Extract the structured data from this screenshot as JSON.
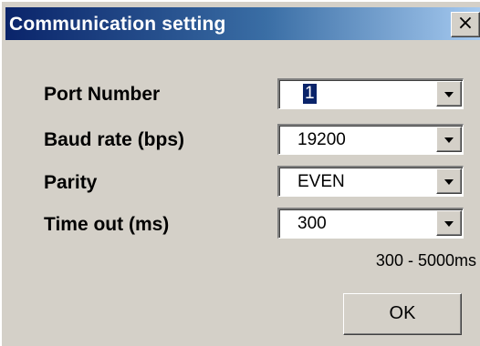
{
  "window": {
    "title": "Communication setting",
    "close_glyph": "×",
    "colors": {
      "title_start": "#0a246a",
      "title_end": "#a6caf0",
      "face": "#d4d0c8"
    }
  },
  "fields": [
    {
      "label": "Port Number",
      "value": "1"
    },
    {
      "label": "Baud rate (bps)",
      "value": "19200"
    },
    {
      "label": "Parity",
      "value": "EVEN"
    },
    {
      "label": "Time out (ms)",
      "value": "300"
    }
  ],
  "range_hint": "300 - 5000ms",
  "ok_label": "OK"
}
